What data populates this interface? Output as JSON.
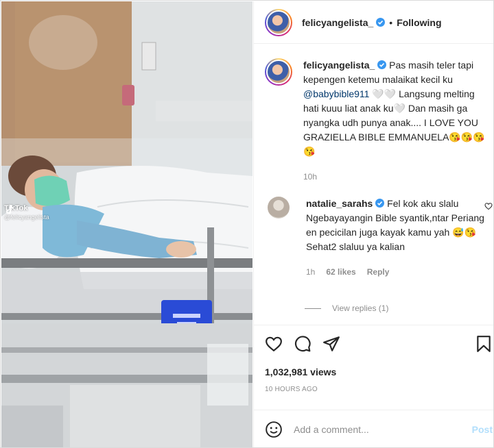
{
  "post": {
    "author": "felicyangelista_",
    "follow_status": "Following",
    "caption": {
      "username": "felicyangelista_",
      "text_1": " Pas masih teler tapi kepengen ketemu malaikat kecil ku ",
      "mention": "@babybible911",
      "text_2": " 🤍🤍 Langsung melting hati kuuu liat anak ku🤍 Dan masih ga nyangka udh punya anak.... I LOVE YOU GRAZIELLA BIBLE EMMANUELA😘😘😘😘",
      "time": "10h"
    },
    "comment": {
      "username": "natalie_sarahs",
      "text": " Fel kok aku slalu Ngebayayangin Bible syantik,ntar Periang en pecicilan juga kayak kamu yah 😅😘 Sehat2 slaluu ya kalian",
      "time": "1h",
      "likes": "62 likes",
      "reply": "Reply",
      "view_replies": "View replies (1)"
    },
    "views": "1,032,981 views",
    "posted": "10 HOURS AGO",
    "add_comment_placeholder": "Add a comment...",
    "post_button": "Post"
  },
  "media": {
    "watermark_brand": "TikTok",
    "watermark_handle": "@felicyangelista"
  },
  "icons": [
    "heart-icon",
    "comment-icon",
    "share-icon",
    "bookmark-icon",
    "emoji-icon",
    "verified-icon"
  ],
  "colors": {
    "verified": "#3897f0",
    "mention": "#00376b",
    "post_button": "#b2dffc",
    "muted": "#8e8e8e"
  }
}
